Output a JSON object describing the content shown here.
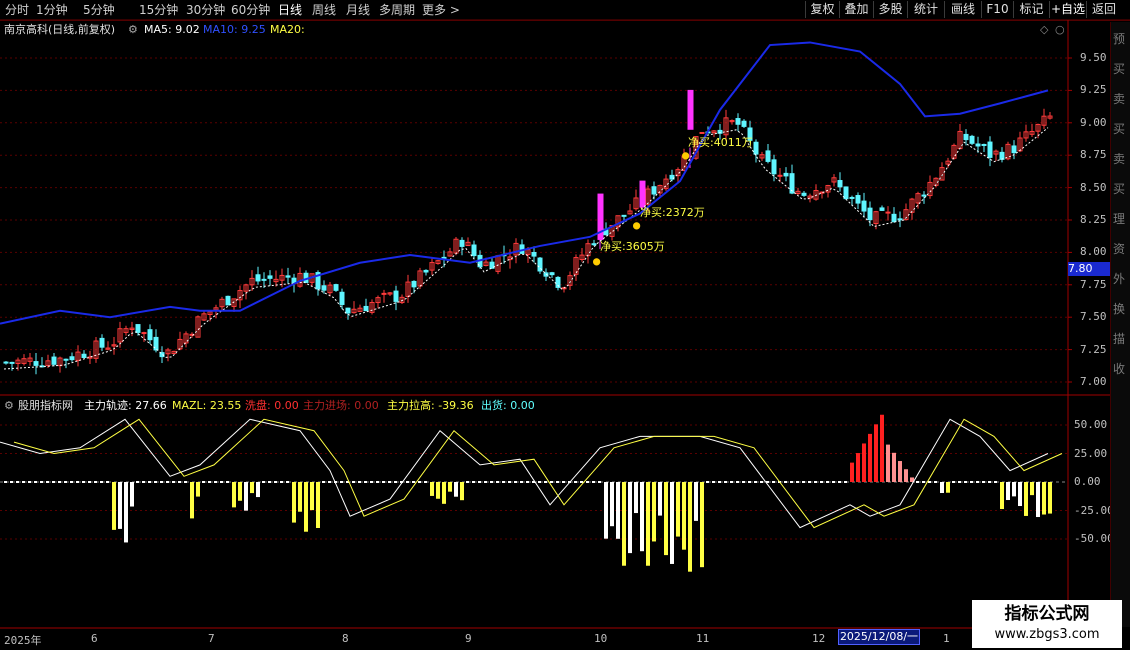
{
  "toolbar": {
    "timeframes": [
      "分时",
      "1分钟",
      "5分钟",
      "15分钟",
      "30分钟",
      "60分钟",
      "日线",
      "周线",
      "月线",
      "多周期",
      "更多 >"
    ],
    "right_buttons": [
      "复权",
      "叠加",
      "多股",
      "统计",
      "画线",
      "F10",
      "标记",
      "+自选",
      "返回"
    ]
  },
  "main_chart": {
    "title": "南京高科(日线,前复权)",
    "ma5_label": "MA5: 9.02",
    "ma10_label": "MA10: 9.25",
    "ma20_label": "MA20:",
    "y_ticks": [
      "9.50",
      "9.25",
      "9.00",
      "8.75",
      "8.50",
      "8.25",
      "8.00",
      "7.75",
      "7.50",
      "7.25",
      "7.00"
    ],
    "price_highlight": "7.80",
    "annotations": [
      "净买:3605万",
      "净买:2372万",
      "净买:4011万"
    ]
  },
  "indicator": {
    "title": "股朋指标网",
    "zlgj_label": "主力轨迹: 27.66",
    "mazl_label": "MAZL: 23.55",
    "xipan_label": "洗盘: 0.00",
    "jinchang_label": "主力进场: 0.00",
    "lagao_label": "主力拉高: -39.36",
    "chuhuo_label": "出货: 0.00",
    "y_ticks": [
      "50.00",
      "25.00",
      "0.00",
      "-25.00",
      "-50.00"
    ]
  },
  "x_axis": {
    "labels": [
      "2025年",
      "6",
      "7",
      "8",
      "9",
      "10",
      "11",
      "12",
      "1"
    ],
    "cursor_date": "2025/12/08/一"
  },
  "watermark": {
    "line1": "指标公式网",
    "line2": "www.zbgs3.com"
  },
  "colors": {
    "up": "#ff3b3b",
    "down": "#5ff5ff",
    "ma_blue": "#1a2ae8",
    "magenta": "#ff33ff",
    "yellow": "#ffff44",
    "bg": "#000000",
    "grid": "#5a0000"
  },
  "chart_data": {
    "type": "line",
    "price_axis_range": [
      7.0,
      9.5
    ],
    "ma_blue_series": [
      {
        "x": "2025-05",
        "y": 7.45
      },
      {
        "x": "2025-06",
        "y": 7.58
      },
      {
        "x": "2025-07",
        "y": 7.55
      },
      {
        "x": "2025-08",
        "y": 7.95
      },
      {
        "x": "2025-09",
        "y": 8.02
      },
      {
        "x": "2025-10",
        "y": 8.25
      },
      {
        "x": "2025-11",
        "y": 9.15
      },
      {
        "x": "2025-11-25",
        "y": 9.62
      },
      {
        "x": "2025-12",
        "y": 9.52
      },
      {
        "x": "2026-01",
        "y": 9.05
      },
      {
        "x": "2026-01-20",
        "y": 9.25
      }
    ],
    "indicator_axis_range": [
      -75,
      65
    ]
  }
}
